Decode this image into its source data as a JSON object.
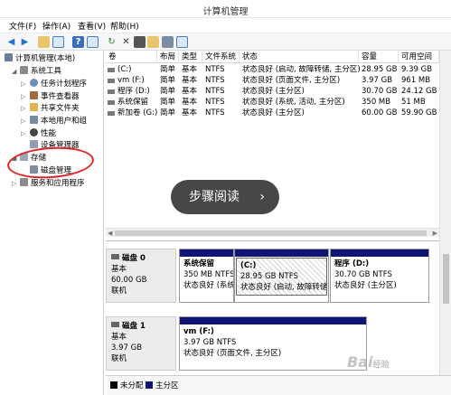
{
  "window": {
    "title": "计算机管理"
  },
  "menu": [
    "文件(F)",
    "操作(A)",
    "查看(V)",
    "帮助(H)"
  ],
  "toolbar": {
    "icons": [
      "back-arrow",
      "forward-arrow",
      "up-folder",
      "show-hide-tree",
      "help",
      "properties-view",
      "refresh",
      "delete",
      "properties",
      "folder-open",
      "disk",
      "view"
    ]
  },
  "tree": {
    "root": "计算机管理(本地)",
    "system_tools": "系统工具",
    "task_scheduler": "任务计划程序",
    "event_viewer": "事件查看器",
    "shared_folders": "共享文件夹",
    "local_users": "本地用户和组",
    "performance": "性能",
    "device_manager": "设备管理器",
    "storage": "存储",
    "disk_management": "磁盘管理",
    "services": "服务和应用程序"
  },
  "volume_table": {
    "columns": [
      "卷",
      "布局",
      "类型",
      "文件系统",
      "状态",
      "容量",
      "可用空间"
    ],
    "rows": [
      [
        "(C:)",
        "简单",
        "基本",
        "NTFS",
        "状态良好 (启动, 故障转储, 主分区)",
        "28.95 GB",
        "9.39 GB"
      ],
      [
        "vm (F:)",
        "简单",
        "基本",
        "NTFS",
        "状态良好 (页面文件, 主分区)",
        "3.97 GB",
        "961 MB"
      ],
      [
        "程序 (D:)",
        "简单",
        "基本",
        "NTFS",
        "状态良好 (主分区)",
        "30.70 GB",
        "24.12 GB"
      ],
      [
        "系统保留",
        "简单",
        "基本",
        "NTFS",
        "状态良好 (系统, 活动, 主分区)",
        "350 MB",
        "51 MB"
      ],
      [
        "新加卷 (G:)",
        "简单",
        "基本",
        "NTFS",
        "状态良好 (主分区)",
        "60.00 GB",
        "59.90 GB"
      ]
    ]
  },
  "disks": [
    {
      "name": "磁盘 0",
      "type": "基本",
      "size": "60.00 GB",
      "status": "联机",
      "partitions": [
        {
          "name": "系统保留",
          "size": "350 MB NTFS",
          "status": "状态良好 (系统"
        },
        {
          "name": "(C:)",
          "size": "28.95 GB NTFS",
          "status": "状态良好 (启动, 故障转储"
        },
        {
          "name": "程序  (D:)",
          "size": "30.70 GB NTFS",
          "status": "状态良好 (主分区)"
        }
      ]
    },
    {
      "name": "磁盘 1",
      "type": "基本",
      "size": "3.97 GB",
      "status": "联机",
      "partitions": [
        {
          "name": "vm  (F:)",
          "size": "3.97 GB NTFS",
          "status": "状态良好 (页面文件, 主分区)"
        }
      ]
    }
  ],
  "legend": {
    "unallocated": "未分配",
    "primary": "主分区"
  },
  "overlay": {
    "label": "步骤阅读",
    "chevron": "›"
  },
  "watermark": {
    "text": "Bai",
    "suffix": "经验"
  },
  "colors": {
    "partition_bar": "#0f1577",
    "unallocated": "#000000",
    "annotation": "#e0262a"
  }
}
